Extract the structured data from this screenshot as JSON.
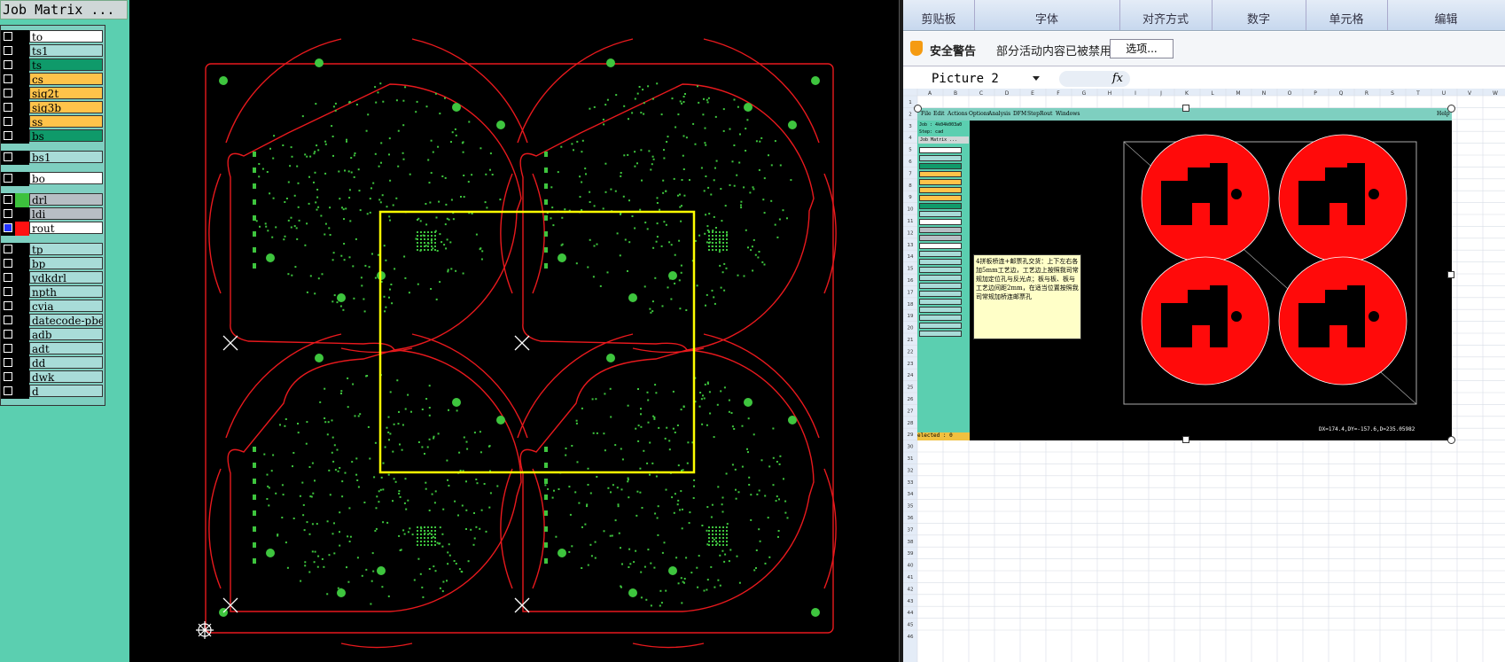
{
  "job_matrix": {
    "title": "Job Matrix ...",
    "layers": [
      {
        "name": "to",
        "swatch": "",
        "fill": "#ffffff"
      },
      {
        "name": "ts1",
        "swatch": "",
        "fill": "#a8dcd8"
      },
      {
        "name": "ts",
        "swatch": "",
        "fill": "#0f9a6a"
      },
      {
        "name": "cs",
        "swatch": "",
        "fill": "#ffc34a"
      },
      {
        "name": "sig2t",
        "swatch": "",
        "fill": "#ffc34a"
      },
      {
        "name": "sig3b",
        "swatch": "",
        "fill": "#ffc34a"
      },
      {
        "name": "ss",
        "swatch": "",
        "fill": "#ffc34a"
      },
      {
        "name": "bs",
        "swatch": "",
        "fill": "#0f9a6a"
      },
      {
        "name": "bs1",
        "swatch": "",
        "fill": "#a8dcd8"
      },
      {
        "name": "bo",
        "swatch": "",
        "fill": "#ffffff"
      },
      {
        "name": "drl",
        "swatch": "#3dc23d",
        "fill": "#b7bec4"
      },
      {
        "name": "ldi",
        "swatch": "",
        "fill": "#b7bec4"
      },
      {
        "name": "rout",
        "swatch": "#ff1111",
        "fill": "#ffffff"
      },
      {
        "name": "tp",
        "swatch": "",
        "fill": "#a8dcd8"
      },
      {
        "name": "bp",
        "swatch": "",
        "fill": "#a8dcd8"
      },
      {
        "name": "ydkdrl",
        "swatch": "",
        "fill": "#a8dcd8"
      },
      {
        "name": "npth",
        "swatch": "",
        "fill": "#a8dcd8"
      },
      {
        "name": "cvia",
        "swatch": "",
        "fill": "#a8dcd8"
      },
      {
        "name": "datecode-pbe",
        "swatch": "",
        "fill": "#a8dcd8"
      },
      {
        "name": "adb",
        "swatch": "",
        "fill": "#a8dcd8"
      },
      {
        "name": "adt",
        "swatch": "",
        "fill": "#a8dcd8"
      },
      {
        "name": "dd",
        "swatch": "",
        "fill": "#a8dcd8"
      },
      {
        "name": "dwk",
        "swatch": "",
        "fill": "#a8dcd8"
      },
      {
        "name": "d",
        "swatch": "",
        "fill": "#a8dcd8"
      }
    ]
  },
  "colors": {
    "board_outline": "#e8191d",
    "selection": "#ffff00",
    "pads": "#3ec53e",
    "background": "#000000",
    "panel": "#5bcfb0"
  },
  "excel": {
    "ribbon_groups": [
      "剪贴板",
      "字体",
      "对齐方式",
      "数字",
      "单元格",
      "编辑"
    ],
    "security": {
      "title": "安全警告",
      "message": "部分活动内容已被禁用。",
      "button": "选项..."
    },
    "name_box": "Picture 2",
    "fx_label": "fx",
    "columns": [
      "A",
      "B",
      "C",
      "D",
      "E",
      "F",
      "G",
      "H",
      "I",
      "J",
      "K",
      "L",
      "M",
      "N",
      "O",
      "P",
      "Q",
      "R",
      "S",
      "T",
      "U",
      "V",
      "W"
    ],
    "rows": [
      "1",
      "2",
      "3",
      "4",
      "5",
      "6",
      "7",
      "8",
      "9",
      "10",
      "11",
      "12",
      "13",
      "14",
      "15",
      "16",
      "17",
      "18",
      "19",
      "20",
      "21",
      "22",
      "23",
      "24",
      "25",
      "26",
      "27",
      "28",
      "29",
      "30",
      "31",
      "32",
      "33",
      "34",
      "35",
      "36",
      "37",
      "38",
      "39",
      "40",
      "41",
      "42",
      "43",
      "44",
      "45",
      "46"
    ]
  },
  "picture": {
    "menu": [
      "File",
      "Edit",
      "Actions",
      "Options",
      "Analysis",
      "DFM",
      "Step",
      "Rout",
      "Windows",
      "Help"
    ],
    "job_label": "Job : 4k04k003a0",
    "step_label": "Step: cad",
    "jm_label": "Job Matrix ...",
    "note": "4拼板桥连+邮票孔交货：上下左右各加5mm工艺边，工艺边上按照我司常规加定位孔与反光点；板与板、板与工艺边间距2mm，在适当位置按照我司常规加桥连邮票孔",
    "status": "DX=174.4,DY=-157.6,D=235.05982",
    "selected": "elected : 0"
  }
}
